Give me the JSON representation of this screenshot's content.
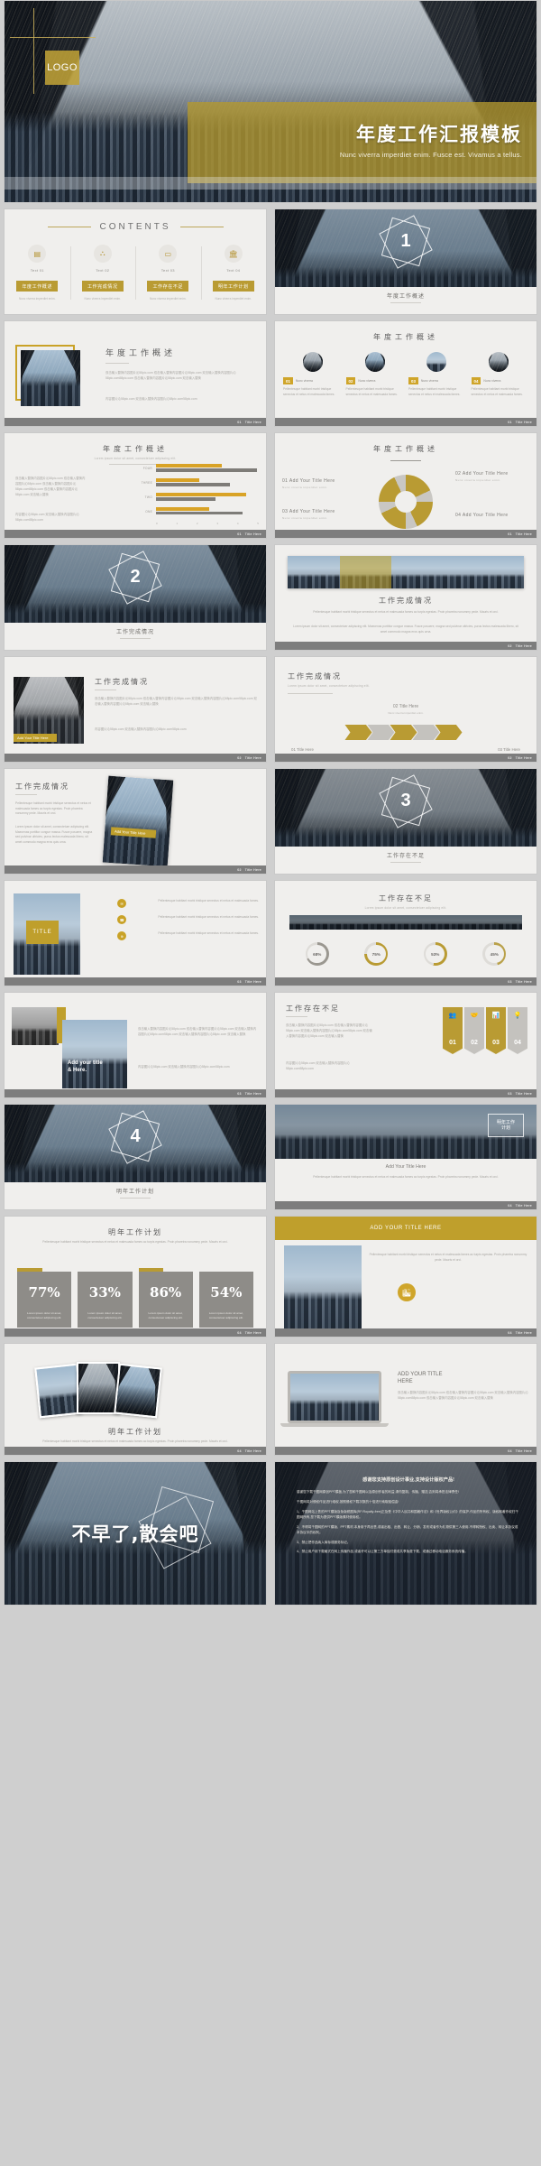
{
  "deck": {
    "cover": {
      "logo": "LOGO",
      "title_zh": "年度工作汇报模板",
      "subtitle_en": "Nunc viverra imperdiet enim. Fusce est. Vivamus a tellus."
    },
    "contents": {
      "heading": "CONTENTS",
      "items": [
        {
          "icon": "presentation-icon",
          "text": "Text 01",
          "chip": "年度工作概述",
          "lorem": "Nunc viverra imperdiet enim."
        },
        {
          "icon": "org-chart-icon",
          "text": "Text 02",
          "chip": "工作完成情况",
          "lorem": "Nunc viverra imperdiet enim."
        },
        {
          "icon": "laptop-icon",
          "text": "Text 03",
          "chip": "工作存在不足",
          "lorem": "Nunc viverra imperdiet enim."
        },
        {
          "icon": "building-icon",
          "text": "Text 04",
          "chip": "明年工作计划",
          "lorem": "Nunc viverra imperdiet enim."
        }
      ]
    },
    "sections": [
      {
        "num": "1",
        "caption": "年度工作概述"
      },
      {
        "num": "2",
        "caption": "工作完成情况"
      },
      {
        "num": "3",
        "caption": "工作存在不足"
      },
      {
        "num": "4",
        "caption": "明年工作计划"
      }
    ],
    "footers": {
      "s01": {
        "num": "01",
        "text": "Title Here"
      },
      "s02": {
        "num": "02",
        "text": "Title Here"
      },
      "s03": {
        "num": "03",
        "text": "Title Here"
      },
      "s04": {
        "num": "04",
        "text": "Title Here"
      }
    },
    "titles": {
      "overview": "年度工作概述",
      "completion": "工作完成情况",
      "shortage": "工作存在不足",
      "nextyear": "明年工作计划"
    },
    "lorem": {
      "zh_block": "双击输入替换内容图片沁58pic.com 双击输入替换内容图片沁58pic.com 双击输入替换内容图片沁58pic.com58pic.com 双击输入替换内容图片沁58pic.com 双击输入替换",
      "zh_block2": "内容图片沁58pic.com 双击输入替换内容图片沁58pic.com58pic.com",
      "en_short": "Lorem ipsum dolor sit amet, consectetuer adipiscing elit.",
      "en_block": "Pellentesque habitant morbi tristique senectus et netus et malesuada fames ac turpis egestas. Proin pharetra nonummy pede. Mauris et orci.",
      "en_block2": "Lorem ipsum dolor sit amet, consectetuer adipiscing elit. Maecenas porttitor congue massa. Fusce posuere, magna sed pulvinar ultricies, purus lectus malesuada libero, sit amet commodo magna eros quis urna.",
      "en_tiny": "Nunc viverra imperdiet enim.",
      "en_tiny2": "Pellentesque habitant morbi tristique senectus et netus et malesuada fames."
    },
    "overview_icons": [
      {
        "num": "01",
        "label": "Nunc viverra",
        "body": "Pellentesque habitant morbi tristique senectus et netus et malesuada fames."
      },
      {
        "num": "02",
        "label": "Nunc viverra",
        "body": "Pellentesque habitant morbi tristique senectus et netus et malesuada fames."
      },
      {
        "num": "03",
        "label": "Nunc viverra",
        "body": "Pellentesque habitant morbi tristique senectus et netus et malesuada fames."
      },
      {
        "num": "04",
        "label": "Nunc viverra",
        "body": "Pellentesque habitant morbi tristique senectus et netus et malesuada fames."
      }
    ],
    "cycle_items": [
      {
        "num": "01",
        "label": "Add Your Title Here",
        "body": "Nunc viverra imperdiet enim."
      },
      {
        "num": "02",
        "label": "Add Your Title Here",
        "body": "Nunc viverra imperdiet enim."
      },
      {
        "num": "03",
        "label": "Add Your Title Here",
        "body": "Nunc viverra imperdiet enim."
      },
      {
        "num": "04",
        "label": "Add Your Title Here",
        "body": "Nunc viverra imperdiet enim."
      }
    ],
    "chevron_slide": {
      "top_label": "02  Title Here",
      "top_body": "Nunc viverra imperdiet enim.",
      "left_label": "01  Title Here",
      "right_label": "03  Title Here"
    },
    "ribbon_items": [
      {
        "num": "01",
        "icon": "people-icon"
      },
      {
        "num": "02",
        "icon": "handshake-icon"
      },
      {
        "num": "03",
        "icon": "chart-icon"
      },
      {
        "num": "04",
        "icon": "bulb-icon"
      }
    ],
    "photo_titles": {
      "title_tile": "TITLE",
      "add_title_here": "Add Your Title Here",
      "add_title_amp": "Add your title\n& Here.",
      "plan_title_zh": "明年工作\n计划",
      "add_your_title_caps": "ADD YOUR TITLE HERE",
      "add_your_title_caps2": "ADD YOUR TITLE\nHERE"
    },
    "closing": {
      "headline": "不早了,散会吧",
      "legal_title": "感谢您支持原创设计事业,支持设计版权产品!",
      "legal_paras": [
        "感谢您下载千图网原创PPT模板,为了您和千图网以及原创作者的利益,请勿复制、传播、赠送,否则将承担法律责任!",
        "千图网将对侵权作品进行维权,按照侵权下载次数的十倍进行索取赔偿金!",
        "1、千图网站上售的PPT模版及免版税图库(RF:Royalty-free)正及受《中华人民共和国著作法》和《世界版权公约》的保护,作品的所有权、版权和著作权归千图网所有,您下载为提供PPT模版素材使用权。",
        "2、不得将千图网的PPT模版、PPT素材,本身用于再出售,或者出租、出借、转让、分销、发布或者作为礼物供第三人使用,不得转授权、出卖、转让本协议或本协议中的权利。",
        "3、禁止把作品纳入商标或服务标记。",
        "4、禁止用户用下载格式在网上传播作品,或者许可以让第三方单独付费或共享免费下载、或通过移动电话服务系统传播。"
      ]
    },
    "chart_data": {
      "type": "bar",
      "title": "年度工作概述",
      "subtitle": "Lorem ipsum dolor sit amet, consectetuer adipiscing elit.",
      "orientation": "horizontal",
      "categories": [
        "FOUR",
        "THREE",
        "TWO",
        "ONE"
      ],
      "series": [
        {
          "name": "Series 1",
          "color": "#d9a326",
          "values": [
            3.2,
            2.1,
            4.4,
            2.6
          ]
        },
        {
          "name": "Series 2",
          "color": "#7e7c78",
          "values": [
            4.9,
            3.6,
            2.9,
            4.2
          ]
        }
      ],
      "xticks": [
        "0",
        "1",
        "2",
        "3",
        "4",
        "5"
      ],
      "xlim": [
        0,
        5
      ],
      "grid": false,
      "legend": false
    },
    "ring_stats": {
      "title": "工作存在不足",
      "subtitle": "Lorem ipsum dolor sit amet, consectetuer adipiscing elit.",
      "values": [
        {
          "label": "68%",
          "pct": 68,
          "color": "#9a9790"
        },
        {
          "label": "75%",
          "pct": 75,
          "color": "#b99b33"
        },
        {
          "label": "53%",
          "pct": 53,
          "color": "#b99b33"
        },
        {
          "label": "45%",
          "pct": 45,
          "color": "#b9a14a"
        }
      ]
    },
    "percent_cards": {
      "title": "明年工作计划",
      "subtitle": "Pellentesque habitant morbi tristique senectus et netus et malesuada fames ac turpis egestas. Proin pharetra nonummy pede. Mauris et orci.",
      "cards": [
        {
          "value": "77%",
          "body": "Lorem ipsum dolor sit amet, consectetuer adipiscing elit.",
          "accent": true
        },
        {
          "value": "33%",
          "body": "Lorem ipsum dolor sit amet, consectetuer adipiscing elit.",
          "accent": false
        },
        {
          "value": "86%",
          "body": "Lorem ipsum dolor sit amet, consectetuer adipiscing elit.",
          "accent": true
        },
        {
          "value": "54%",
          "body": "Lorem ipsum dolor sit amet, consectetuer adipiscing elit.",
          "accent": false
        }
      ]
    },
    "colors": {
      "gold": "#b99b33",
      "gold_light": "#cfa52a",
      "grey": "#8e8c88",
      "slide_bg": "#f0efed",
      "footer": "#7d7d7d"
    }
  }
}
